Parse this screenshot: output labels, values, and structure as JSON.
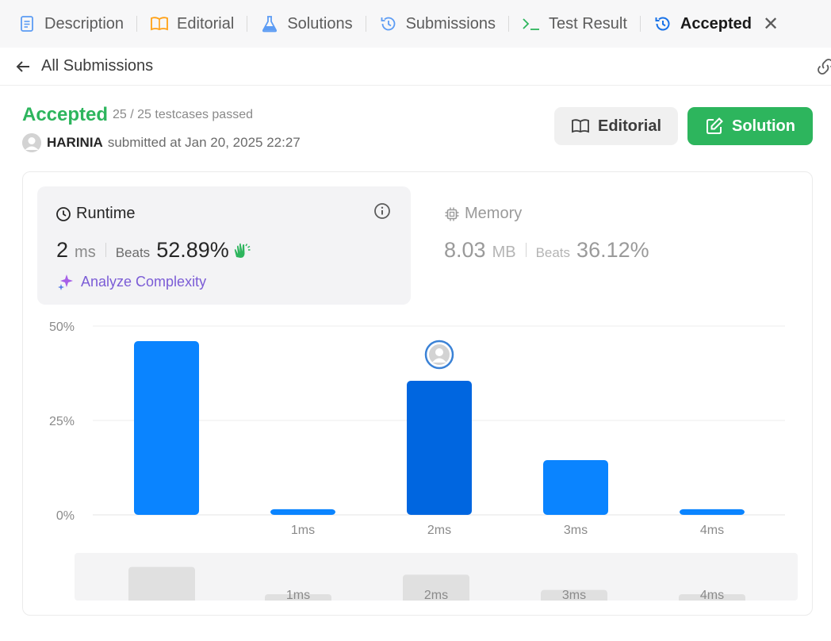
{
  "tabs": [
    {
      "label": "Description",
      "icon": "description-icon",
      "color": "#5c9cf4"
    },
    {
      "label": "Editorial",
      "icon": "book-icon",
      "color": "#ffa116"
    },
    {
      "label": "Solutions",
      "icon": "flask-icon",
      "color": "#5c9cf4"
    },
    {
      "label": "Submissions",
      "icon": "history-icon",
      "color": "#5c9cf4"
    },
    {
      "label": "Test Result",
      "icon": "terminal-icon",
      "color": "#2db55d"
    },
    {
      "label": "Accepted",
      "icon": "history-icon",
      "color": "#1a73e8",
      "active": true
    }
  ],
  "subheader": {
    "back_label": "All Submissions"
  },
  "result": {
    "status": "Accepted",
    "testcases": "25 / 25 testcases passed",
    "username": "HARINIA",
    "submitted_text": "submitted at Jan 20, 2025 22:27"
  },
  "buttons": {
    "editorial": "Editorial",
    "solution": "Solution"
  },
  "runtime": {
    "title": "Runtime",
    "value": "2",
    "unit": "ms",
    "beats_label": "Beats",
    "beats": "52.89%",
    "analyze": "Analyze Complexity"
  },
  "memory": {
    "title": "Memory",
    "value": "8.03",
    "unit": "MB",
    "beats_label": "Beats",
    "beats": "36.12%"
  },
  "colors": {
    "accent_green": "#2db55d",
    "bar": "#0a84ff",
    "bar_active": "#0066e0",
    "navigator": "#e0e0e0"
  },
  "chart_data": {
    "type": "bar",
    "categories": [
      "",
      "1ms",
      "2ms",
      "3ms",
      "4ms"
    ],
    "values": [
      46,
      1.5,
      35.5,
      14.5,
      1.5
    ],
    "highlight_index": 2,
    "y_ticks": [
      "0%",
      "25%",
      "50%"
    ],
    "ylim": [
      0,
      50
    ],
    "grid": true,
    "navigator_labels": [
      "",
      "1ms",
      "2ms",
      "3ms",
      "4ms"
    ]
  }
}
